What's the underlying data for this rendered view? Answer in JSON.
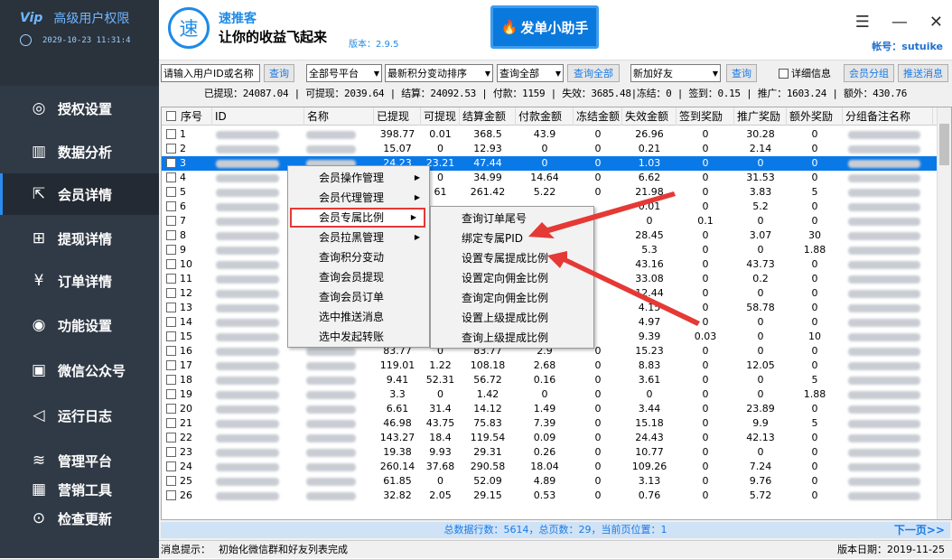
{
  "sidebar": {
    "title": "高级用户权限",
    "datetime": "2029-10-23 11:31:4",
    "logo": "Vip",
    "items": [
      {
        "label": "授权设置",
        "icon": "globe-icon",
        "glyph": "◎"
      },
      {
        "label": "数据分析",
        "icon": "chart-icon",
        "glyph": "▥"
      },
      {
        "label": "会员详情",
        "icon": "external-link-icon",
        "glyph": "⇱"
      },
      {
        "label": "提现详情",
        "icon": "search-grid-icon",
        "glyph": "⊞"
      },
      {
        "label": "订单详情",
        "icon": "yen-doc-icon",
        "glyph": "¥"
      },
      {
        "label": "功能设置",
        "icon": "chat-icon",
        "glyph": "◉"
      },
      {
        "label": "微信公众号",
        "icon": "wechat-icon",
        "glyph": "▣"
      },
      {
        "label": "运行日志",
        "icon": "speaker-icon",
        "glyph": "◁"
      },
      {
        "label": "管理平台",
        "icon": "layers-icon",
        "glyph": "≋"
      },
      {
        "label": "营销工具",
        "icon": "bar-chart-icon",
        "glyph": "▦"
      },
      {
        "label": "检查更新",
        "icon": "update-icon",
        "glyph": "⊙"
      }
    ]
  },
  "header": {
    "logo_char": "速",
    "app_name": "速推客",
    "slogan": "让你的收益飞起来",
    "version": "版本：2.9.5",
    "banner": "发单小助手",
    "account": "帐号：sutuike"
  },
  "toolbar": {
    "search_placeholder": "请输入用户ID或名称",
    "search_btn": "查询",
    "platform": "全部号平台",
    "sort": "最新积分变动排序",
    "filter": "查询全部",
    "query_all": "查询全部",
    "relation": "新加好友",
    "query_btn": "查询",
    "details": "详细信息",
    "member_group": "会员分组",
    "push_msg": "推送消息"
  },
  "stats": "已提现：24087.04 | 可提现：2039.64 | 结算：24092.53 | 付款：1159 | 失效：3685.48|冻结：0 | 签到：0.15 | 推广：1603.24 | 额外：430.76",
  "columns": [
    "序号",
    "ID",
    "名称",
    "已提现",
    "可提现",
    "结算金额",
    "付款金额",
    "冻结金额",
    "失效金额",
    "签到奖励",
    "推广奖励",
    "额外奖励",
    "分组备注名称"
  ],
  "rows": [
    [
      "1",
      "398.77",
      "0.01",
      "368.5",
      "43.9",
      "0",
      "26.96",
      "0",
      "30.28",
      "0"
    ],
    [
      "2",
      "15.07",
      "0",
      "12.93",
      "0",
      "0",
      "0.21",
      "0",
      "2.14",
      "0"
    ],
    [
      "3",
      "24.23",
      "23.21",
      "47.44",
      "0",
      "0",
      "1.03",
      "0",
      "0",
      "0"
    ],
    [
      "4",
      "",
      "0",
      "34.99",
      "14.64",
      "0",
      "6.62",
      "0",
      "31.53",
      "0"
    ],
    [
      "5",
      "",
      "61",
      "261.42",
      "5.22",
      "0",
      "21.98",
      "0",
      "3.83",
      "5"
    ],
    [
      "6",
      "",
      "",
      "",
      "",
      "",
      "0.01",
      "0",
      "5.2",
      "0"
    ],
    [
      "7",
      "",
      "",
      "",
      "",
      "",
      "0",
      "0.1",
      "0",
      "0"
    ],
    [
      "8",
      "",
      "",
      "",
      "",
      "",
      "28.45",
      "0",
      "3.07",
      "30"
    ],
    [
      "9",
      "",
      "",
      "",
      "",
      "",
      "5.3",
      "0",
      "0",
      "1.88"
    ],
    [
      "10",
      "",
      "",
      "",
      "",
      "",
      "43.16",
      "0",
      "43.73",
      "0"
    ],
    [
      "11",
      "",
      "",
      "",
      "",
      "",
      "33.08",
      "0",
      "0.2",
      "0"
    ],
    [
      "12",
      "",
      "",
      "",
      "",
      "",
      "12.44",
      "0",
      "0",
      "0"
    ],
    [
      "13",
      "",
      "",
      "",
      "",
      "",
      "4.15",
      "0",
      "58.78",
      "0"
    ],
    [
      "14",
      "",
      "",
      "",
      "",
      "",
      "4.97",
      "0",
      "0",
      "0"
    ],
    [
      "15",
      "",
      "",
      "",
      "",
      "",
      "9.39",
      "0.03",
      "0",
      "10"
    ],
    [
      "16",
      "83.77",
      "0",
      "83.77",
      "2.9",
      "0",
      "15.23",
      "0",
      "0",
      "0"
    ],
    [
      "17",
      "119.01",
      "1.22",
      "108.18",
      "2.68",
      "0",
      "8.83",
      "0",
      "12.05",
      "0"
    ],
    [
      "18",
      "9.41",
      "52.31",
      "56.72",
      "0.16",
      "0",
      "3.61",
      "0",
      "0",
      "5"
    ],
    [
      "19",
      "3.3",
      "0",
      "1.42",
      "0",
      "0",
      "0",
      "0",
      "0",
      "1.88"
    ],
    [
      "20",
      "6.61",
      "31.4",
      "14.12",
      "1.49",
      "0",
      "3.44",
      "0",
      "23.89",
      "0"
    ],
    [
      "21",
      "46.98",
      "43.75",
      "75.83",
      "7.39",
      "0",
      "15.18",
      "0",
      "9.9",
      "5"
    ],
    [
      "22",
      "143.27",
      "18.4",
      "119.54",
      "0.09",
      "0",
      "24.43",
      "0",
      "42.13",
      "0"
    ],
    [
      "23",
      "19.38",
      "9.93",
      "29.31",
      "0.26",
      "0",
      "10.77",
      "0",
      "0",
      "0"
    ],
    [
      "24",
      "260.14",
      "37.68",
      "290.58",
      "18.04",
      "0",
      "109.26",
      "0",
      "7.24",
      "0"
    ],
    [
      "25",
      "61.85",
      "0",
      "52.09",
      "4.89",
      "0",
      "3.13",
      "0",
      "9.76",
      "0"
    ],
    [
      "26",
      "32.82",
      "2.05",
      "29.15",
      "0.53",
      "0",
      "0.76",
      "0",
      "5.72",
      "0"
    ]
  ],
  "context_menu": [
    "会员操作管理",
    "会员代理管理",
    "会员专属比例",
    "会员拉黑管理",
    "查询积分变动",
    "查询会员提现",
    "查询会员订单",
    "选中推送消息",
    "选中发起转账"
  ],
  "submenu": [
    "查询订单尾号",
    "绑定专属PID",
    "设置专属提成比例",
    "设置定向佣金比例",
    "查询定向佣金比例",
    "设置上级提成比例",
    "查询上级提成比例"
  ],
  "footer": {
    "summary": "总数据行数：5614，总页数：29，当前页位置：1",
    "next": "下一页>>"
  },
  "status": {
    "message_label": "消息提示：",
    "message": "初始化微信群和好友列表完成",
    "date": "版本日期：2019-11-25"
  },
  "colors": {
    "sidebar": "#303a46",
    "accent": "#1b7be6",
    "selected_row": "#0a79e8",
    "highlight": "#e53935"
  }
}
